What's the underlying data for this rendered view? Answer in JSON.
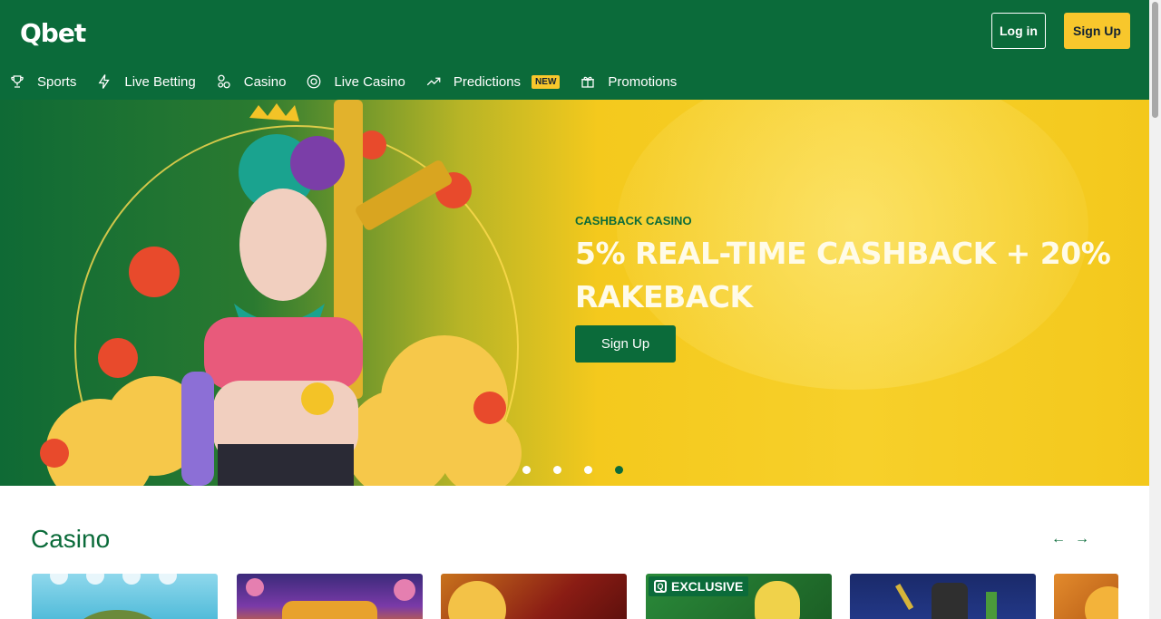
{
  "header": {
    "logo": "Qbet",
    "login_label": "Log in",
    "signup_label": "Sign Up"
  },
  "nav": {
    "items": [
      {
        "label": "Sports",
        "icon": "trophy-icon"
      },
      {
        "label": "Live Betting",
        "icon": "lightning-icon"
      },
      {
        "label": "Casino",
        "icon": "dice-icon"
      },
      {
        "label": "Live Casino",
        "icon": "chip-icon"
      },
      {
        "label": "Predictions",
        "icon": "trend-up-icon",
        "badge": "NEW"
      },
      {
        "label": "Promotions",
        "icon": "gift-icon"
      }
    ]
  },
  "hero": {
    "eyebrow": "CASHBACK CASINO",
    "title": "5% REAL-TIME CASHBACK + 20% RAKEBACK",
    "cta_label": "Sign Up",
    "slide_count": 4,
    "active_slide": 4
  },
  "casino": {
    "title": "Casino",
    "exclusive_badge": "EXCLUSIVE",
    "prev_icon": "arrow-left-icon",
    "next_icon": "arrow-right-icon"
  },
  "colors": {
    "brand_green": "#0b6b3a",
    "accent_yellow": "#f8c72c"
  }
}
